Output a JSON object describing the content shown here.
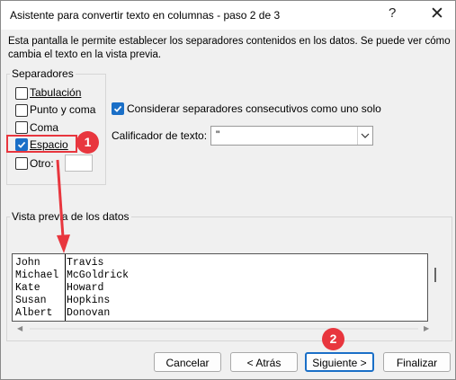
{
  "window": {
    "title": "Asistente para convertir texto en columnas - paso 2 de 3",
    "help_glyph": "?",
    "close_glyph": "✕"
  },
  "description": "Esta pantalla le permite establecer los separadores contenidos en los datos. Se puede ver cómo cambia el texto en la vista previa.",
  "separators": {
    "group_label": "Separadores",
    "items": [
      {
        "label": "Tabulación",
        "checked": false
      },
      {
        "label": "Punto y coma",
        "checked": false
      },
      {
        "label": "Coma",
        "checked": false
      },
      {
        "label": "Espacio",
        "checked": true
      },
      {
        "label": "Otro:",
        "checked": false
      }
    ],
    "other_value": ""
  },
  "consecutive": {
    "label": "Considerar separadores consecutivos como uno solo",
    "checked": true
  },
  "qualifier": {
    "label": "Calificador de texto:",
    "value": "\""
  },
  "preview": {
    "group_label": "Vista previa de los datos",
    "col1": [
      "John",
      "Michael",
      "Kate",
      "Susan",
      "Albert"
    ],
    "col2": [
      "Travis",
      "McGoldrick",
      "Howard",
      "Hopkins",
      "Donovan"
    ]
  },
  "buttons": {
    "cancel": "Cancelar",
    "back": "< Atrás",
    "next": "Siguiente >",
    "finish": "Finalizar"
  },
  "annotations": {
    "badge1": "1",
    "badge2": "2",
    "color": "#e8363e"
  },
  "colors": {
    "accent": "#1a6fc7"
  }
}
